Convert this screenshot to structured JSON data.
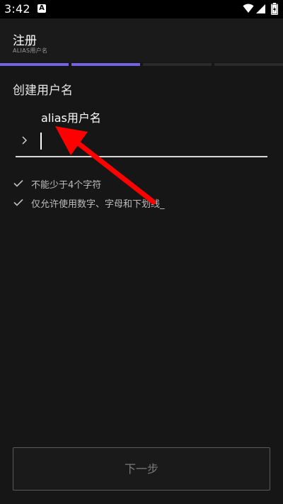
{
  "status_bar": {
    "time": "3:42",
    "notification_glyph": "A",
    "icons": [
      "notification-icon",
      "wifi-icon",
      "signal-icon",
      "battery-icon"
    ]
  },
  "header": {
    "title": "注册",
    "subtitle": "ALIAS用户名"
  },
  "progress": {
    "total_steps": 4,
    "completed_steps": 2,
    "active_color": "#7461e6",
    "inactive_color": "#2a2a2a"
  },
  "form": {
    "section_title": "创建用户名",
    "field_label": "alias用户名",
    "field_value": "",
    "prompt_icon": "chevron-right-icon"
  },
  "rules": [
    {
      "icon": "check-icon",
      "text": "不能少于4个字符"
    },
    {
      "icon": "check-icon",
      "text": "仅允许使用数字、字母和下划线_"
    }
  ],
  "annotation": {
    "type": "arrow",
    "color": "#ff0000",
    "points_to": "field_label"
  },
  "footer": {
    "next_button_label": "下一步"
  },
  "colors": {
    "background": "#161616",
    "accent": "#7461e6",
    "annotation": "#ff0000"
  }
}
